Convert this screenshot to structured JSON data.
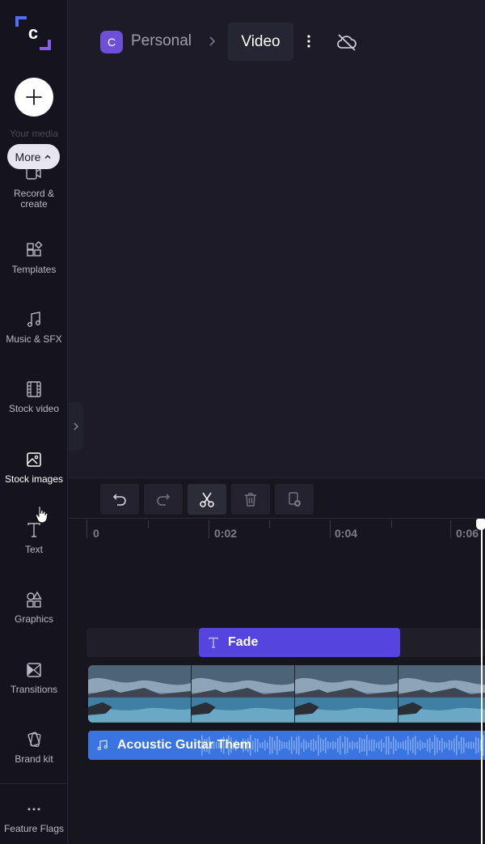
{
  "app": {
    "logo_letter": "c",
    "colors": {
      "accent": "#5544dd",
      "audio": "#3a74e0",
      "avatar": "#6d4fd8",
      "background": "#1c1b27",
      "sidebar": "#15141e"
    }
  },
  "sidebar": {
    "create_icon": "plus-icon",
    "your_media_label": "Your media",
    "more_label": "More",
    "items": [
      {
        "id": "record",
        "label_line1": "Record &",
        "label_line2": "create",
        "icon": "camera-icon"
      },
      {
        "id": "templates",
        "label": "Templates",
        "icon": "templates-icon"
      },
      {
        "id": "music",
        "label": "Music & SFX",
        "icon": "music-note-icon"
      },
      {
        "id": "stock-video",
        "label": "Stock video",
        "icon": "film-icon"
      },
      {
        "id": "stock-images",
        "label": "Stock images",
        "icon": "image-icon",
        "active": true
      },
      {
        "id": "text",
        "label": "Text",
        "icon": "text-icon"
      },
      {
        "id": "graphics",
        "label": "Graphics",
        "icon": "shapes-icon"
      },
      {
        "id": "transitions",
        "label": "Transitions",
        "icon": "transition-icon"
      },
      {
        "id": "brand-kit",
        "label": "Brand kit",
        "icon": "brand-icon"
      },
      {
        "id": "feature-flags",
        "label": "Feature Flags",
        "icon": "ellipsis-icon"
      }
    ]
  },
  "header": {
    "avatar_letter": "C",
    "workspace": "Personal",
    "project_title": "Video",
    "sync_status_icon": "cloud-off-icon"
  },
  "timeline": {
    "toolbar": [
      {
        "id": "undo",
        "icon": "undo-icon"
      },
      {
        "id": "redo",
        "icon": "redo-icon"
      },
      {
        "id": "split",
        "icon": "scissors-icon"
      },
      {
        "id": "delete",
        "icon": "trash-icon"
      },
      {
        "id": "duplicate",
        "icon": "duplicate-icon"
      }
    ],
    "ruler_labels": [
      "0",
      "0:02",
      "0:04",
      "0:06"
    ],
    "text_clip_label": "Fade",
    "audio_clip_label": "Acoustic Guitar Them"
  }
}
